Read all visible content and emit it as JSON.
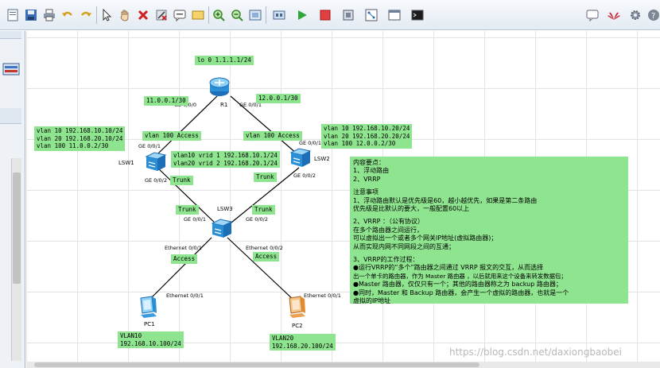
{
  "toolbar": {
    "left_icons": [
      "new-file-icon",
      "save-icon",
      "print-icon",
      "undo-icon",
      "redo-icon",
      "select-pointer-icon",
      "hand-pan-icon",
      "delete-icon",
      "delete-link-icon",
      "text-note-icon",
      "rectangle-icon",
      "zoom-in-icon",
      "zoom-out-icon",
      "fit-view-icon",
      "start-icon",
      "stop-icon",
      "capture-icon",
      "topology-icon",
      "cli-window-icon"
    ],
    "right_icons": [
      "chat-icon",
      "huawei-logo-icon",
      "settings-gear-icon",
      "help-icon"
    ]
  },
  "topology": {
    "r1": {
      "name": "R1",
      "loopback": "lo 0 1.1.1.1/24",
      "left_port": "GE 0/0/0",
      "right_port": "GE 0/0/1"
    },
    "left_link_net": "11.0.0.1/30",
    "right_link_net": "12.0.0.1/30",
    "lsw1": {
      "name": "LSW1",
      "vlan_box": [
        "vlan 10 192.168.10.10/24",
        "vlan 20 192.168.20.10/24",
        "vlan 100 11.0.0.2/30"
      ],
      "access_label": "vlan 100 Access",
      "vrrp_box": [
        "vlan10 vrid 1 192.168.10.1/24",
        "vlan20 vrid 2 192.168.20.1/24"
      ],
      "port_up": "GE 0/0/1",
      "port_down": "GE 0/0/2",
      "trunk_label": "Trunk"
    },
    "lsw2": {
      "name": "LSW2",
      "vlan_box": [
        "vlan 10 192.168.10.20/24",
        "vlan 20 192.168.20.20/24",
        "vlan 100 12.0.0.2/30"
      ],
      "access_label": "vlan 100 Access",
      "port_up": "GE 0/0/1",
      "port_down": "GE 0/0/2",
      "trunk_label": "Trunk"
    },
    "lsw3": {
      "name": "LSW3",
      "port_left": "GE 0/0/1",
      "port_right": "GE 0/0/2",
      "trunk_left": "Trunk",
      "trunk_right": "Trunk",
      "eth_left": "Ethernet 0/0/1",
      "eth_right": "Ethernet 0/0/2",
      "access_left": "Access",
      "access_right": "Access"
    },
    "pc1": {
      "name": "PC1",
      "port": "Ethernet 0/0/1",
      "box": [
        "VLAN10",
        "192.168.10.100/24"
      ]
    },
    "pc2": {
      "name": "PC2",
      "port": "Ethernet 0/0/1",
      "box": [
        "VLAN20",
        "192.168.20.100/24"
      ]
    }
  },
  "notes": [
    "内容要点：",
    "1、浮动路由",
    "2、VRRP",
    "",
    "注意事项",
    "1、浮动路由默认是优先级是60，越小越优先，如果是第二条路由",
    "优先级是比默认的要大，一般配置60以上",
    "",
    "2、VRRP ：（公有协议）",
    "在多个路由器之间运行，",
    "可以虚拟出一个或者多个网关IP地址(虚拟路由器)；",
    "从而实现内网不同网段之间的互通；",
    "",
    "3、VRRP的工作过程：",
    "●运行VRRP的“多个”路由器之间通过 VRRP 报文的交互，从而选择",
    "出一个单卡的路由器，作为 Master 路由器 ，以后就用来这个设备来转发数据包；",
    "●Master 路由器，仅仅只有一个；其他的路由器称之为 backup 路由器；",
    "●同时，Master 和 Backup 路由器，会产生一个虚拟的路由器，也就是一个",
    "虚拟的IP地址"
  ],
  "watermark": "https://blog.csdn.net/daxiongbaobei",
  "colors": {
    "label_green": "#8fe58f",
    "link_black": "#000000",
    "device_blue": "#2b8fd6",
    "pc2_orange": "#e38b2e"
  }
}
